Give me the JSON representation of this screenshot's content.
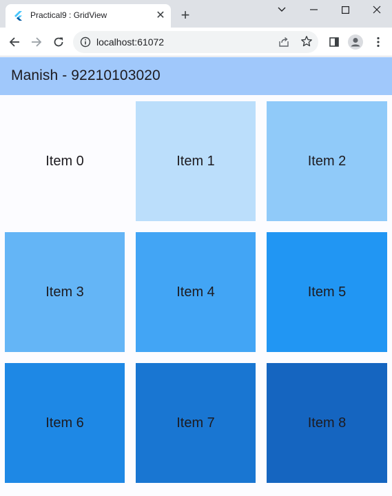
{
  "browser": {
    "tab_title": "Practical9 : GridView",
    "url": "localhost:61072"
  },
  "app": {
    "title": "Manish - 92210103020",
    "accent_color": "#a0c8fb"
  },
  "grid": {
    "items": [
      {
        "label": "Item 0",
        "color": "#fcfcff"
      },
      {
        "label": "Item 1",
        "color": "#bbdefb"
      },
      {
        "label": "Item 2",
        "color": "#90caf9"
      },
      {
        "label": "Item 3",
        "color": "#64b5f6"
      },
      {
        "label": "Item 4",
        "color": "#42a5f5"
      },
      {
        "label": "Item 5",
        "color": "#2196f3"
      },
      {
        "label": "Item 6",
        "color": "#1e88e5"
      },
      {
        "label": "Item 7",
        "color": "#1976d2"
      },
      {
        "label": "Item 8",
        "color": "#1565c0"
      }
    ]
  }
}
